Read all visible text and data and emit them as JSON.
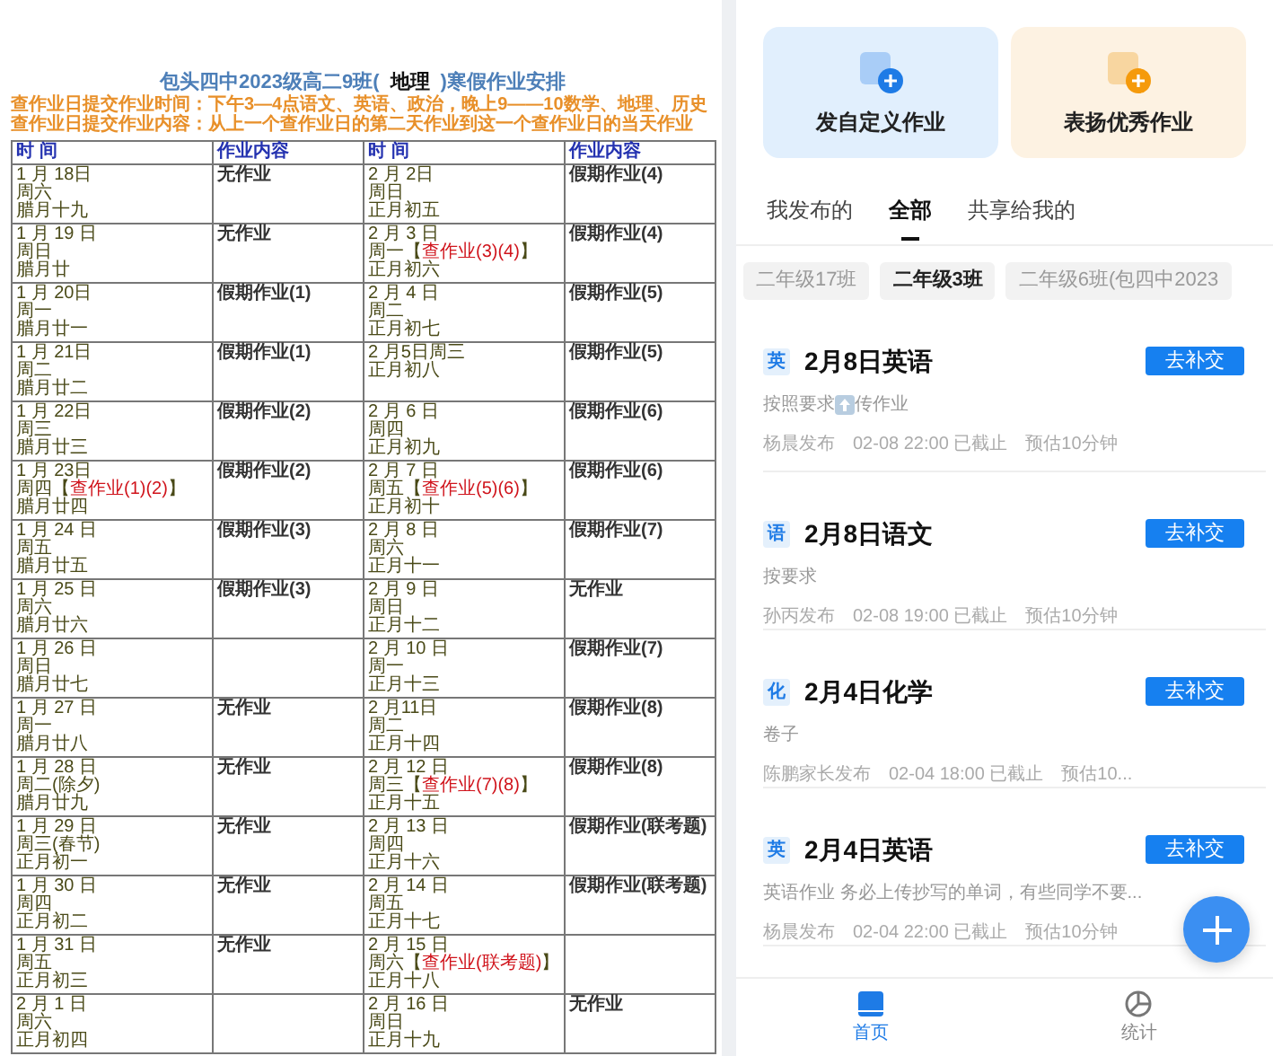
{
  "document": {
    "title_before": "包头四中2023级高二9班(",
    "title_subject": "地理",
    "title_after": ")寒假作业安排",
    "notes": [
      "查作业日提交作业时间：下午3—4点语文、英语、政治，晚上9——10数学、地理、历史",
      "查作业日提交作业内容：从上一个查作业日的第二天作业到这一个查作业日的当天作业"
    ],
    "columns": [
      "时 间",
      "作业内容",
      "时 间",
      "作业内容"
    ],
    "rows": [
      {
        "left": {
          "date": "1 月 18日",
          "weekday": "周六",
          "lunar": "腊月十九",
          "homework": "无作业"
        },
        "right": {
          "date": "2 月 2日",
          "weekday": "周日",
          "lunar": "正月初五",
          "homework": "假期作业(4)"
        }
      },
      {
        "left": {
          "date": "1 月 19 日",
          "weekday": "周日",
          "lunar": "腊月廿",
          "homework": "无作业"
        },
        "right": {
          "date": "2 月 3 日",
          "weekday": "周一【",
          "check": "查作业(3)(4)",
          "weekday_end": "】",
          "lunar": "正月初六",
          "homework": "假期作业(4)"
        }
      },
      {
        "left": {
          "date": "1 月 20日",
          "weekday": "周一",
          "lunar": "腊月廿一",
          "homework": "假期作业(1)"
        },
        "right": {
          "date": "2 月 4 日",
          "weekday": "周二",
          "lunar": "正月初七",
          "homework": "假期作业(5)"
        }
      },
      {
        "left": {
          "date": "1 月 21日",
          "weekday": "周二",
          "lunar": "腊月廿二",
          "homework": "假期作业(1)"
        },
        "right": {
          "date": "2 月5日周三",
          "lunar": "正月初八",
          "homework": "假期作业(5)"
        }
      },
      {
        "left": {
          "date": "1 月 22日",
          "weekday": "周三",
          "lunar": "腊月廿三",
          "homework": "假期作业(2)"
        },
        "right": {
          "date": "2 月 6 日",
          "weekday": "周四",
          "lunar": "正月初九",
          "homework": "假期作业(6)"
        }
      },
      {
        "left": {
          "date": "1 月 23日",
          "weekday": "周四【",
          "check": "查作业(1)(2)",
          "weekday_end": "】",
          "lunar": "腊月廿四",
          "homework": "假期作业(2)"
        },
        "right": {
          "date": "2 月 7 日",
          "weekday": "周五【",
          "check": "查作业(5)(6)",
          "weekday_end": "】",
          "lunar": "正月初十",
          "homework": "假期作业(6)"
        }
      },
      {
        "left": {
          "date": "1 月 24 日",
          "weekday": "周五",
          "lunar": "腊月廿五",
          "homework": "假期作业(3)"
        },
        "right": {
          "date": "2 月 8 日",
          "weekday": "周六",
          "lunar": "正月十一",
          "homework": "假期作业(7)"
        }
      },
      {
        "left": {
          "date": "1 月 25 日",
          "weekday": "周六",
          "lunar": "腊月廿六",
          "homework": "假期作业(3)"
        },
        "right": {
          "date": "2 月 9 日",
          "weekday": "周日",
          "lunar": "正月十二",
          "homework": "无作业"
        }
      },
      {
        "left": {
          "date": "1 月 26 日",
          "weekday": "周日",
          "lunar": "腊月廿七"
        },
        "right": {
          "date": "2 月 10 日",
          "weekday": "周一",
          "lunar": "正月十三",
          "homework": "假期作业(7)"
        }
      },
      {
        "left": {
          "date": "1 月 27 日",
          "weekday": "周一",
          "lunar": "腊月廿八",
          "homework": "无作业"
        },
        "right": {
          "date": "2 月11日",
          "weekday": "周二",
          "lunar": "正月十四",
          "homework": "假期作业(8)"
        }
      },
      {
        "left": {
          "date": "1 月 28 日",
          "weekday": "周二(除夕)",
          "lunar": "腊月廿九",
          "homework": "无作业"
        },
        "right": {
          "date": "2 月 12 日",
          "weekday": "周三【",
          "check": "查作业(7)(8)",
          "weekday_end": "】",
          "lunar": "正月十五",
          "homework": "假期作业(8)"
        }
      },
      {
        "left": {
          "date": "1 月 29 日",
          "weekday": "周三(春节)",
          "lunar": "正月初一",
          "homework": "无作业"
        },
        "right": {
          "date": "2 月 13 日",
          "weekday": "周四",
          "lunar": "正月十六",
          "homework": "假期作业(联考题)"
        }
      },
      {
        "left": {
          "date": "1 月 30 日",
          "weekday": "周四",
          "lunar": "正月初二",
          "homework": "无作业"
        },
        "right": {
          "date": "2 月 14 日",
          "weekday": "周五",
          "lunar": "正月十七",
          "homework": "假期作业(联考题)"
        }
      },
      {
        "left": {
          "date": "1 月 31 日",
          "weekday": "周五",
          "lunar": "正月初三",
          "homework": "无作业"
        },
        "right": {
          "date": "2 月 15 日",
          "weekday": "周六【",
          "check": "查作业(联考题)",
          "weekday_end": "】",
          "lunar": "正月十八"
        }
      },
      {
        "left": {
          "date": "2 月 1 日",
          "weekday": "周六",
          "lunar": "正月初四"
        },
        "right": {
          "date": "2 月 16 日",
          "weekday": "周日",
          "lunar": "正月十九",
          "homework": "无作业"
        }
      }
    ]
  },
  "app": {
    "actions": [
      {
        "label": "发自定义作业",
        "kind": "custom"
      },
      {
        "label": "表扬优秀作业",
        "kind": "praise"
      }
    ],
    "tabs": [
      {
        "label": "我发布的",
        "selected": false
      },
      {
        "label": "全部",
        "selected": true
      },
      {
        "label": "共享给我的",
        "selected": false
      }
    ],
    "classes": [
      {
        "label": "二年级17班",
        "selected": false
      },
      {
        "label": "二年级3班",
        "selected": true
      },
      {
        "label": "二年级6班(包四中2023",
        "selected": false
      }
    ],
    "assignments": [
      {
        "subject": "英",
        "title": "2月8日英语",
        "button": "去补交",
        "description": [
          {
            "kind": "text",
            "text": "按照要求"
          },
          {
            "kind": "icon"
          },
          {
            "kind": "text",
            "text": "传作业"
          }
        ],
        "author": "杨晨发布",
        "deadline": "02-08 22:00 已截止",
        "estimate": "预估10分钟"
      },
      {
        "subject": "语",
        "title": "2月8日语文",
        "button": "去补交",
        "description": [
          {
            "kind": "text",
            "text": "按要求"
          }
        ],
        "author": "孙丙发布",
        "deadline": "02-08 19:00 已截止",
        "estimate": "预估10分钟"
      },
      {
        "subject": "化",
        "title": "2月4日化学",
        "button": "去补交",
        "description": [
          {
            "kind": "text",
            "text": "卷子"
          }
        ],
        "author": "陈鹏家长发布",
        "deadline": "02-04 18:00 已截止",
        "estimate": "预估10..."
      },
      {
        "subject": "英",
        "title": "2月4日英语",
        "button": "去补交",
        "description": [
          {
            "kind": "text",
            "text": "英语作业 务必上传抄写的单词，有些同学不要..."
          }
        ],
        "author": "杨晨发布",
        "deadline": "02-04 22:00 已截止",
        "estimate": "预估10分钟"
      }
    ],
    "nav": [
      {
        "label": "首页",
        "kind": "home",
        "selected": true
      },
      {
        "label": "统计",
        "kind": "stats",
        "selected": false
      }
    ]
  }
}
